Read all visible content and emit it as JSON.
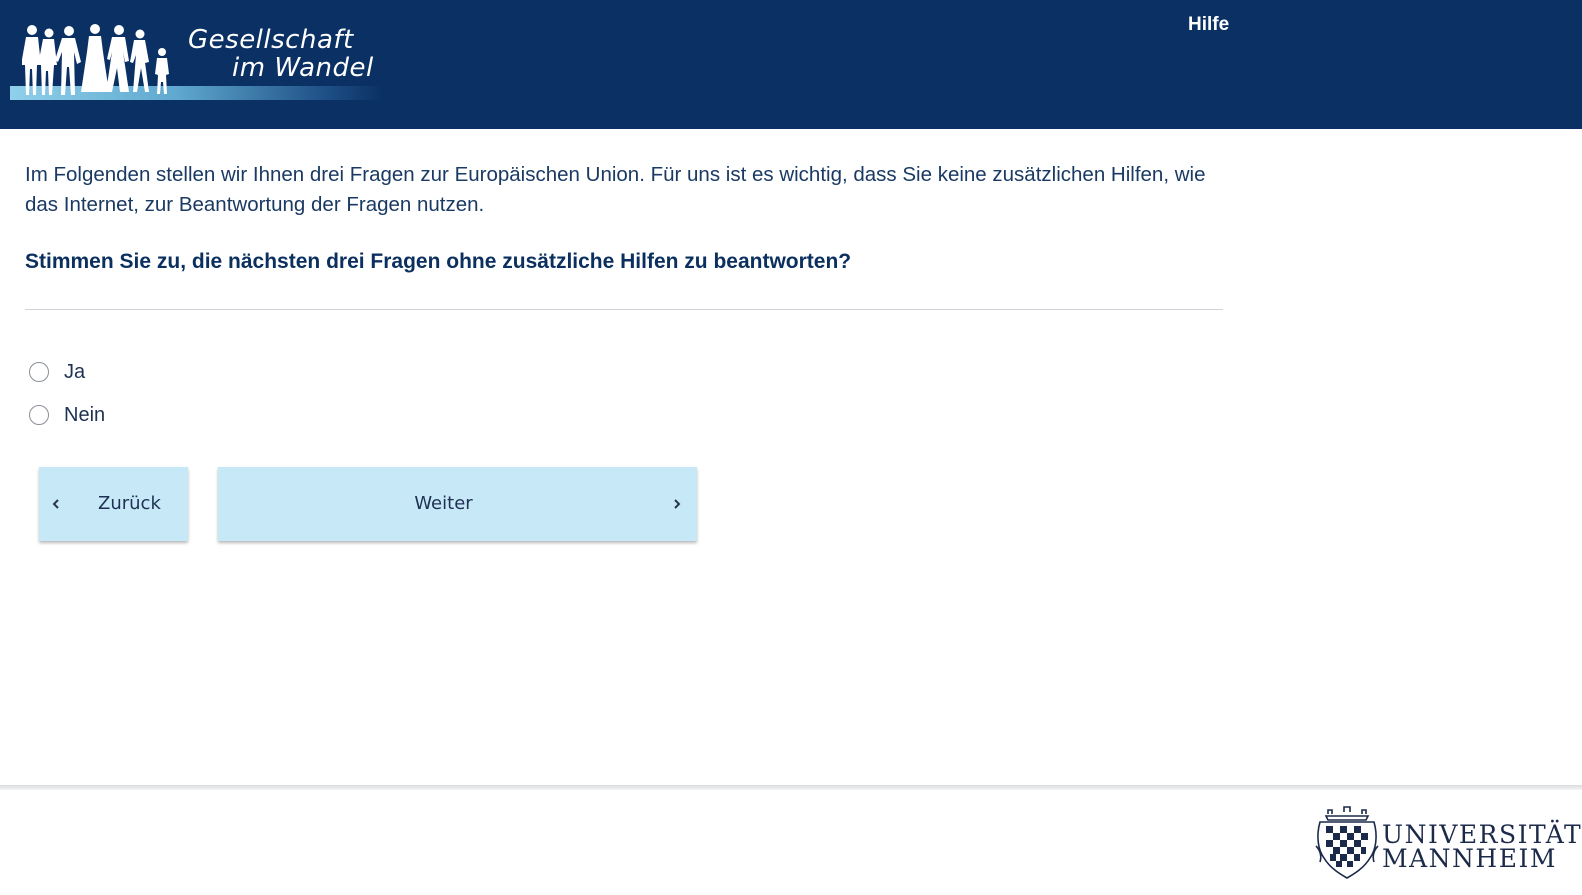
{
  "header": {
    "logo": {
      "line1": "Gesellschaft",
      "line2": "im Wandel"
    },
    "help_label": "Hilfe"
  },
  "content": {
    "intro": "Im Folgenden stellen wir Ihnen drei Fragen zur Europäischen Union. Für uns ist es wichtig, dass Sie keine zusätzlichen Hilfen, wie das Internet, zur Beantwortung der Fragen nutzen.",
    "question": "Stimmen Sie zu, die nächsten drei Fragen ohne zusätzliche Hilfen zu beantworten?",
    "options": [
      {
        "label": "Ja",
        "selected": false
      },
      {
        "label": "Nein",
        "selected": false
      }
    ]
  },
  "navigation": {
    "back_label": "Zurück",
    "next_label": "Weiter"
  },
  "footer": {
    "logo": {
      "line1": "UNIVERSITÄT",
      "line2": "MANNHEIM"
    }
  },
  "colors": {
    "header_bg": "#0b3164",
    "button_bg": "#c7e8f6",
    "text_primary": "#1a3a63"
  }
}
